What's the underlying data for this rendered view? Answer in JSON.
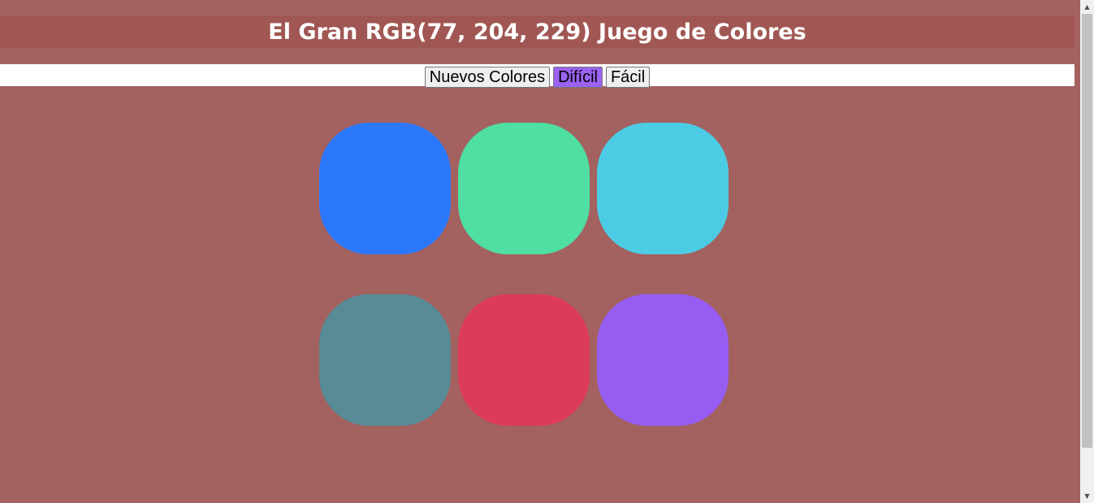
{
  "header": {
    "title": "El Gran RGB(77, 204, 229) Juego de Colores"
  },
  "controls": {
    "new_colors_label": "Nuevos Colores",
    "hard_label": "Difícil",
    "easy_label": "Fácil",
    "selected_mode": "Difícil",
    "active_color": "#9b62f3"
  },
  "squares": [
    {
      "color": "#2b78fd"
    },
    {
      "color": "#4fdfa2"
    },
    {
      "color": "#4ccce4"
    },
    {
      "color": "#588b96"
    },
    {
      "color": "#dd3b5c"
    },
    {
      "color": "#975df3"
    }
  ],
  "colors": {
    "background": "#a36160",
    "header_bg": "#a05753"
  },
  "scrollbar": {
    "up_icon": "arrow-up-icon",
    "down_icon": "arrow-down-icon"
  }
}
